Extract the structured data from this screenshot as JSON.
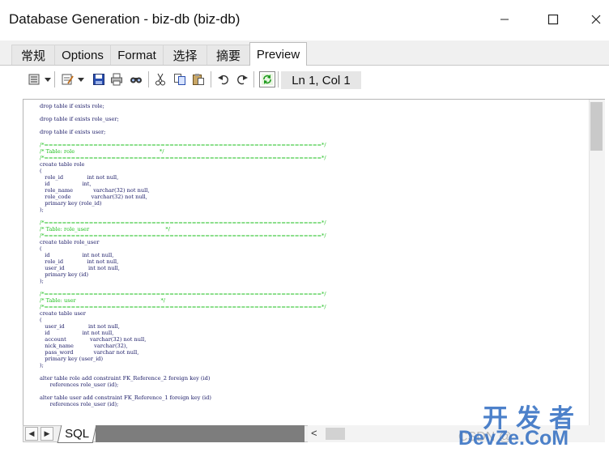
{
  "window": {
    "title": "Database Generation - biz-db (biz-db)",
    "minimize_glyph": "–",
    "maximize_glyph": "☐",
    "close_glyph": "✕"
  },
  "tabs": [
    {
      "label": "常规",
      "active": false
    },
    {
      "label": "Options",
      "active": false
    },
    {
      "label": "Format",
      "active": false
    },
    {
      "label": "选择",
      "active": false
    },
    {
      "label": "摘要",
      "active": false
    },
    {
      "label": "Preview",
      "active": true
    }
  ],
  "toolbar": {
    "icons": [
      "edit-menu-icon",
      "properties-menu-icon",
      "save-icon",
      "print-icon",
      "find-icon",
      "cut-icon",
      "copy-icon",
      "paste-icon",
      "undo-icon",
      "redo-icon",
      "refresh-icon"
    ],
    "cursor_position": "Ln 1, Col 1"
  },
  "editor": {
    "lines": [
      {
        "t": "drop table if exists role;",
        "c": false
      },
      {
        "t": "",
        "c": false
      },
      {
        "t": "drop table if exists role_user;",
        "c": false
      },
      {
        "t": "",
        "c": false
      },
      {
        "t": "drop table if exists user;",
        "c": false
      },
      {
        "t": "",
        "c": false
      },
      {
        "t": "/*==============================================================*/",
        "c": true
      },
      {
        "t": "/* Table: role                                                  */",
        "c": true
      },
      {
        "t": "/*==============================================================*/",
        "c": true
      },
      {
        "t": "create table role",
        "c": false
      },
      {
        "t": "(",
        "c": false
      },
      {
        "t": "   role_id              int not null,",
        "c": false
      },
      {
        "t": "   id                   int,",
        "c": false
      },
      {
        "t": "   role_name            varchar(32) not null,",
        "c": false
      },
      {
        "t": "   role_code            varchar(32) not null,",
        "c": false
      },
      {
        "t": "   primary key (role_id)",
        "c": false
      },
      {
        "t": ");",
        "c": false
      },
      {
        "t": "",
        "c": false
      },
      {
        "t": "/*==============================================================*/",
        "c": true
      },
      {
        "t": "/* Table: role_user                                             */",
        "c": true
      },
      {
        "t": "/*==============================================================*/",
        "c": true
      },
      {
        "t": "create table role_user",
        "c": false
      },
      {
        "t": "(",
        "c": false
      },
      {
        "t": "   id                   int not null,",
        "c": false
      },
      {
        "t": "   role_id              int not null,",
        "c": false
      },
      {
        "t": "   user_id              int not null,",
        "c": false
      },
      {
        "t": "   primary key (id)",
        "c": false
      },
      {
        "t": ");",
        "c": false
      },
      {
        "t": "",
        "c": false
      },
      {
        "t": "/*==============================================================*/",
        "c": true
      },
      {
        "t": "/* Table: user                                                  */",
        "c": true
      },
      {
        "t": "/*==============================================================*/",
        "c": true
      },
      {
        "t": "create table user",
        "c": false
      },
      {
        "t": "(",
        "c": false
      },
      {
        "t": "   user_id              int not null,",
        "c": false
      },
      {
        "t": "   id                   int not null,",
        "c": false
      },
      {
        "t": "   account              varchar(32) not null,",
        "c": false
      },
      {
        "t": "   nick_name            varchar(32),",
        "c": false
      },
      {
        "t": "   pass_word            varchar not null,",
        "c": false
      },
      {
        "t": "   primary key (user_id)",
        "c": false
      },
      {
        "t": ");",
        "c": false
      },
      {
        "t": "",
        "c": false
      },
      {
        "t": "alter table role add constraint FK_Reference_2 foreign key (id)",
        "c": false
      },
      {
        "t": "      references role_user (id);",
        "c": false
      },
      {
        "t": "",
        "c": false
      },
      {
        "t": "alter table user add constraint FK_Reference_1 foreign key (id)",
        "c": false
      },
      {
        "t": "      references role_user (id);",
        "c": false
      }
    ]
  },
  "bottom": {
    "sheet_tab": "SQL",
    "nav_prev": "◀",
    "nav_next": "▶",
    "hscroll_left": "<"
  },
  "watermark": {
    "cn": "开发者",
    "en": "DevZe.CoM",
    "small": "CSDN @"
  }
}
